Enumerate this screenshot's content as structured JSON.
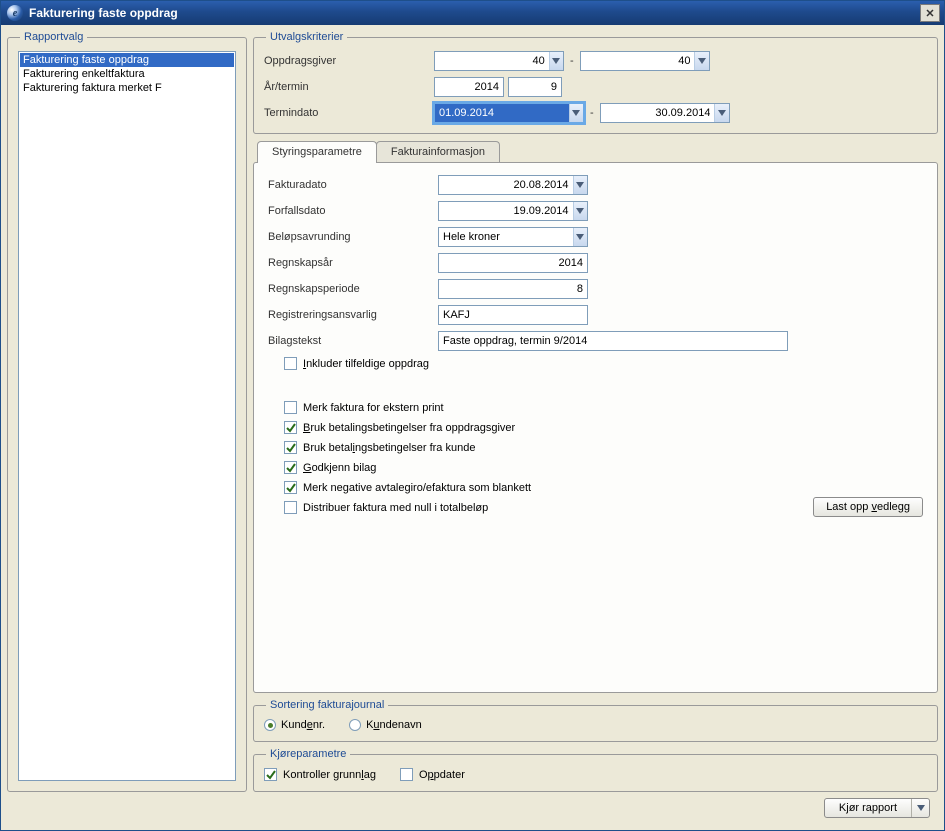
{
  "window": {
    "title": "Fakturering faste oppdrag"
  },
  "sidebar": {
    "legend": "Rapportvalg",
    "items": [
      {
        "label": "Fakturering faste oppdrag",
        "selected": true
      },
      {
        "label": "Fakturering enkeltfaktura",
        "selected": false
      },
      {
        "label": "Fakturering faktura merket F",
        "selected": false
      }
    ]
  },
  "criteria": {
    "legend": "Utvalgskriterier",
    "oppdragsgiver_label": "Oppdragsgiver",
    "oppdragsgiver_from": "40",
    "oppdragsgiver_to": "40",
    "aar_termin_label": "År/termin",
    "aar": "2014",
    "termin": "9",
    "termindato_label": "Termindato",
    "termindato_from": "01.09.2014",
    "termindato_to": "30.09.2014"
  },
  "tabs": {
    "tab1": "Styringsparametre",
    "tab2": "Fakturainformasjon"
  },
  "control": {
    "fakturadato_label": "Fakturadato",
    "fakturadato": "20.08.2014",
    "forfallsdato_label": "Forfallsdato",
    "forfallsdato": "19.09.2014",
    "avrunding_label": "Beløpsavrunding",
    "avrunding": "Hele kroner",
    "regnskapsaar_label": "Regnskapsår",
    "regnskapsaar": "2014",
    "regnskapsperiode_label": "Regnskapsperiode",
    "regnskapsperiode": "8",
    "ansvarlig_label": "Registreringsansvarlig",
    "ansvarlig": "KAFJ",
    "bilagstekst_label": "Bilagstekst",
    "bilagstekst": "Faste oppdrag, termin 9/2014",
    "checkboxes": {
      "inkluder_tilfeldige": {
        "label_pre": "I",
        "label": "nkluder tilfeldige oppdrag",
        "checked": false
      },
      "ekstern_print": {
        "label": "Merk faktura for ekstern print",
        "checked": false
      },
      "bruk_bet_oppdragsgiver": {
        "label_pre": "B",
        "label": "ruk betalingsbetingelser fra oppdragsgiver",
        "checked": true
      },
      "bruk_bet_kunde": {
        "label": "Bruk betalingsbetingelser fra kunde",
        "underline_char": "i",
        "checked": true
      },
      "godkjenn_bilag": {
        "label_pre": "G",
        "label": "odkjenn bilag",
        "checked": true
      },
      "merk_negative": {
        "label": "Merk negative avtalegiro/efaktura som blankett",
        "checked": true
      },
      "distribuer_null": {
        "label": "Distribuer faktura med null i totalbeløp",
        "checked": false
      }
    },
    "upload_button_pre": "Last opp ",
    "upload_button_u": "v",
    "upload_button_post": "edlegg"
  },
  "sortering": {
    "legend": "Sortering fakturajournal",
    "kundenr_pre": "Kund",
    "kundenr_u": "e",
    "kundenr_post": "nr.",
    "kundenavn_pre": "K",
    "kundenavn_u": "u",
    "kundenavn_post": "ndenavn",
    "selected": "kundenr"
  },
  "kjoreparam": {
    "legend": "Kjøreparametre",
    "kontroller_pre": "Kontroller grunn",
    "kontroller_u": "l",
    "kontroller_post": "ag",
    "kontroller_checked": true,
    "oppdater_pre": "O",
    "oppdater_u": "p",
    "oppdater_post": "pdater",
    "oppdater_checked": false
  },
  "footer": {
    "run_pre": "K",
    "run_u": "j",
    "run_post": "ør rapport"
  }
}
